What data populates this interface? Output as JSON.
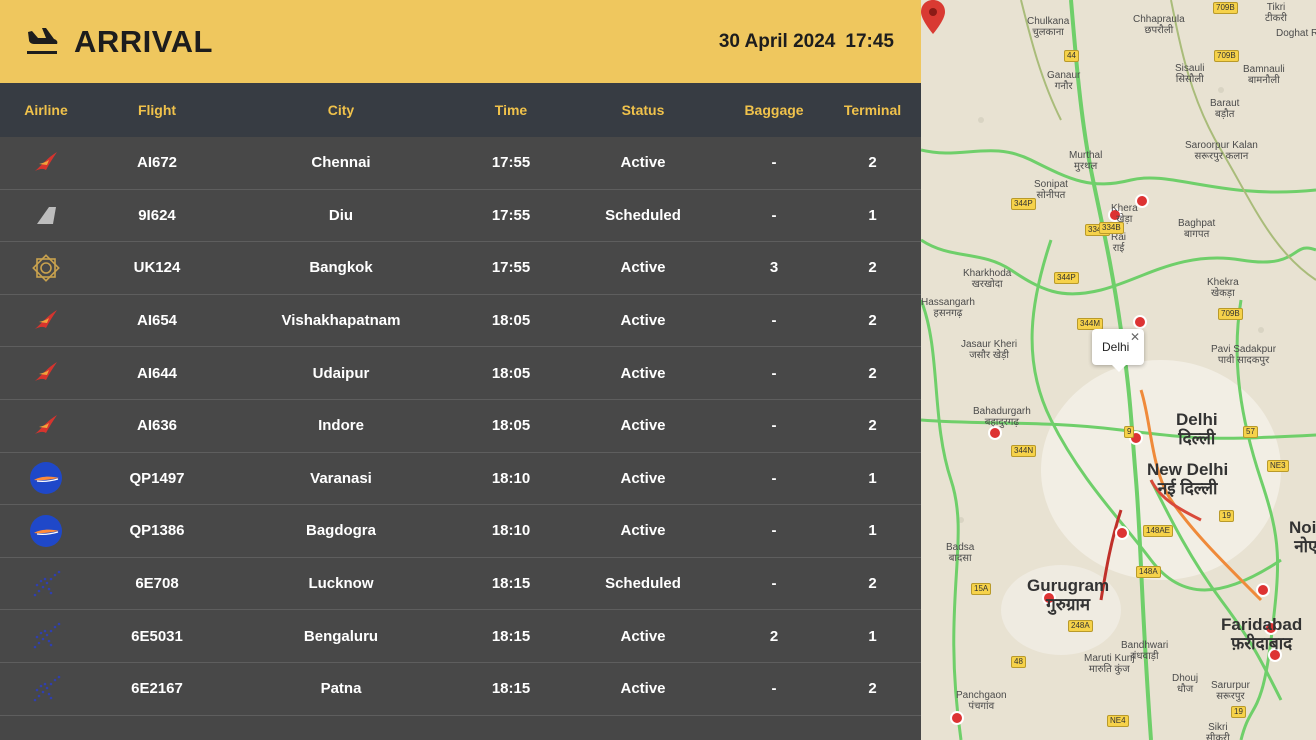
{
  "header": {
    "title": "ARRIVAL",
    "date": "30 April 2024",
    "time": "17:45"
  },
  "columns": {
    "airline": "Airline",
    "flight": "Flight",
    "city": "City",
    "time": "Time",
    "status": "Status",
    "baggage": "Baggage",
    "terminal": "Terminal"
  },
  "flights": [
    {
      "airline_icon": "air-india-logo-icon",
      "flight": "AI672",
      "city": "Chennai",
      "time": "17:55",
      "status": "Active",
      "baggage": "-",
      "terminal": "2"
    },
    {
      "airline_icon": "alliance-air-logo-icon",
      "flight": "9I624",
      "city": "Diu",
      "time": "17:55",
      "status": "Scheduled",
      "baggage": "-",
      "terminal": "1"
    },
    {
      "airline_icon": "vistara-logo-icon",
      "flight": "UK124",
      "city": "Bangkok",
      "time": "17:55",
      "status": "Active",
      "baggage": "3",
      "terminal": "2"
    },
    {
      "airline_icon": "air-india-logo-icon",
      "flight": "AI654",
      "city": "Vishakhapatnam",
      "time": "18:05",
      "status": "Active",
      "baggage": "-",
      "terminal": "2"
    },
    {
      "airline_icon": "air-india-logo-icon",
      "flight": "AI644",
      "city": "Udaipur",
      "time": "18:05",
      "status": "Active",
      "baggage": "-",
      "terminal": "2"
    },
    {
      "airline_icon": "air-india-logo-icon",
      "flight": "AI636",
      "city": "Indore",
      "time": "18:05",
      "status": "Active",
      "baggage": "-",
      "terminal": "2"
    },
    {
      "airline_icon": "akasa-air-logo-icon",
      "flight": "QP1497",
      "city": "Varanasi",
      "time": "18:10",
      "status": "Active",
      "baggage": "-",
      "terminal": "1"
    },
    {
      "airline_icon": "akasa-air-logo-icon",
      "flight": "QP1386",
      "city": "Bagdogra",
      "time": "18:10",
      "status": "Active",
      "baggage": "-",
      "terminal": "1"
    },
    {
      "airline_icon": "indigo-logo-icon",
      "flight": "6E708",
      "city": "Lucknow",
      "time": "18:15",
      "status": "Scheduled",
      "baggage": "-",
      "terminal": "2"
    },
    {
      "airline_icon": "indigo-logo-icon",
      "flight": "6E5031",
      "city": "Bengaluru",
      "time": "18:15",
      "status": "Active",
      "baggage": "2",
      "terminal": "1"
    },
    {
      "airline_icon": "indigo-logo-icon",
      "flight": "6E2167",
      "city": "Patna",
      "time": "18:15",
      "status": "Active",
      "baggage": "-",
      "terminal": "2"
    }
  ],
  "map": {
    "popup_label": "Delhi",
    "places": [
      {
        "name": "Chulkana",
        "local": "चुलकाना"
      },
      {
        "name": "Chhapraula",
        "local": "छपरौली"
      },
      {
        "name": "Doghat Rur",
        "local": ""
      },
      {
        "name": "Tikri",
        "local": "टीकरी"
      },
      {
        "name": "Ganaur",
        "local": "गनौर"
      },
      {
        "name": "Sisauli",
        "local": "सिसौली"
      },
      {
        "name": "Bamnauli",
        "local": "बामनौली"
      },
      {
        "name": "Baraut",
        "local": "बड़ौत"
      },
      {
        "name": "Murthal",
        "local": "मुरथल"
      },
      {
        "name": "Saroorpur Kalan",
        "local": "सरूरपुर कलान"
      },
      {
        "name": "Sonipat",
        "local": "सोनीपत"
      },
      {
        "name": "Khera",
        "local": "खेड़ा"
      },
      {
        "name": "Rai",
        "local": "राई"
      },
      {
        "name": "Baghpat",
        "local": "बागपत"
      },
      {
        "name": "Kharkhoda",
        "local": "खरखोदा"
      },
      {
        "name": "Khekra",
        "local": "खेकड़ा"
      },
      {
        "name": "Hassangarh",
        "local": "हसनगढ़"
      },
      {
        "name": "Jasaur Kheri",
        "local": "जसौर खेड़ी"
      },
      {
        "name": "Pavi Sadakpur",
        "local": "पावी सादकपुर"
      },
      {
        "name": "Bahadurgarh",
        "local": "बहादुरगढ़"
      },
      {
        "name": "Delhi",
        "local": "दिल्ली"
      },
      {
        "name": "New Delhi",
        "local": "नई दिल्ली"
      },
      {
        "name": "Badsa",
        "local": "बादसा"
      },
      {
        "name": "Gurugram",
        "local": "गुरुग्राम"
      },
      {
        "name": "Bandhwari",
        "local": "बंधवाड़ी"
      },
      {
        "name": "Faridabad",
        "local": "फ़रीदाबाद"
      },
      {
        "name": "Maruti Kunj",
        "local": "मारुति कुंज"
      },
      {
        "name": "Dhouj",
        "local": "धौज"
      },
      {
        "name": "Sarurpur",
        "local": "सरूरपुर"
      },
      {
        "name": "Panchgaon",
        "local": "पंचगांव"
      },
      {
        "name": "Sikri",
        "local": "सीकरी"
      },
      {
        "name": "Noida",
        "local": "नोएडा"
      }
    ],
    "shields": [
      "44",
      "709B",
      "709B",
      "344P",
      "334B",
      "334B",
      "344P",
      "344M",
      "709B",
      "344N",
      "9",
      "57",
      "NE3",
      "148AE",
      "19",
      "148A",
      "15A",
      "248A",
      "48",
      "NE4",
      "19"
    ]
  }
}
